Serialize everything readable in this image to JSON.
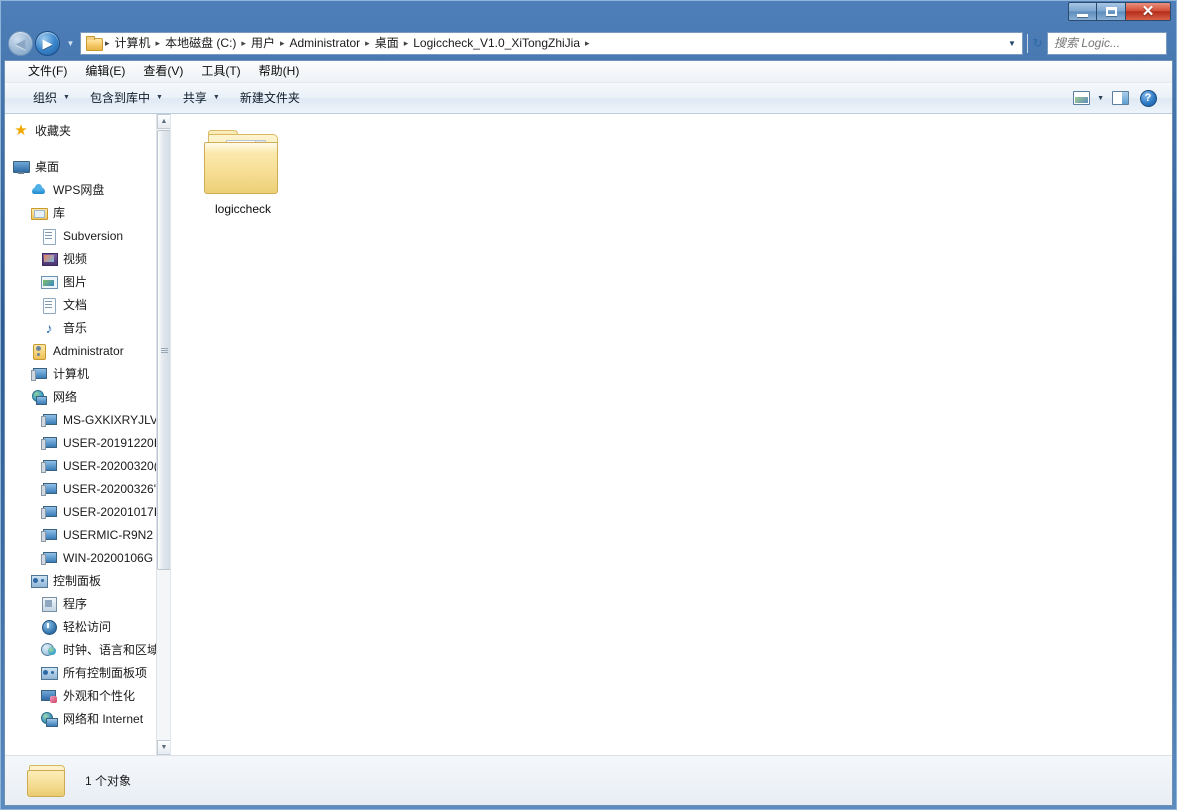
{
  "window": {
    "controls": {
      "minimize": "─",
      "maximize": "□",
      "close": "✕"
    }
  },
  "navbar": {
    "back_glyph": "◀",
    "forward_glyph": "▶",
    "recent_caret": "▼",
    "address_caret": "▼",
    "refresh_glyph": "↻",
    "breadcrumbs": [
      "计算机",
      "本地磁盘 (C:)",
      "用户",
      "Administrator",
      "桌面",
      "Logiccheck_V1.0_XiTongZhiJia"
    ],
    "separator": "▸",
    "search": {
      "placeholder": "搜索 Logic...",
      "value": "",
      "icon": "⚲"
    }
  },
  "menubar": {
    "items": [
      "文件(F)",
      "编辑(E)",
      "查看(V)",
      "工具(T)",
      "帮助(H)"
    ]
  },
  "commandbar": {
    "buttons": [
      {
        "label": "组织",
        "caret": "▼"
      },
      {
        "label": "包含到库中",
        "caret": "▼"
      },
      {
        "label": "共享",
        "caret": "▼"
      },
      {
        "label": "新建文件夹",
        "caret": ""
      }
    ],
    "view_caret": "▼",
    "help_glyph": "?"
  },
  "navpane": {
    "items": [
      {
        "label": "收藏夹",
        "icon": "star-icon",
        "level": 1,
        "gap_after": true
      },
      {
        "label": "桌面",
        "icon": "desktop-icon",
        "level": 1
      },
      {
        "label": "WPS网盘",
        "icon": "cloud-icon",
        "level": 2
      },
      {
        "label": "库",
        "icon": "library-icon",
        "level": 2
      },
      {
        "label": "Subversion",
        "icon": "document-icon",
        "level": 3
      },
      {
        "label": "视频",
        "icon": "video-icon",
        "level": 3
      },
      {
        "label": "图片",
        "icon": "picture-icon",
        "level": 3
      },
      {
        "label": "文档",
        "icon": "document-icon",
        "level": 3
      },
      {
        "label": "音乐",
        "icon": "music-icon",
        "level": 3
      },
      {
        "label": "Administrator",
        "icon": "user-folder-icon",
        "level": 2
      },
      {
        "label": "计算机",
        "icon": "computer-icon",
        "level": 2
      },
      {
        "label": "网络",
        "icon": "network-icon",
        "level": 2
      },
      {
        "label": "MS-GXKIXRYJLV",
        "icon": "computer-icon",
        "level": 3
      },
      {
        "label": "USER-20191220I",
        "icon": "computer-icon",
        "level": 3
      },
      {
        "label": "USER-20200320(",
        "icon": "computer-icon",
        "level": 3
      },
      {
        "label": "USER-20200326'",
        "icon": "computer-icon",
        "level": 3
      },
      {
        "label": "USER-20201017I",
        "icon": "computer-icon",
        "level": 3
      },
      {
        "label": "USERMIC-R9N2\u0015",
        "icon": "computer-icon",
        "level": 3
      },
      {
        "label": "WIN-20200106G",
        "icon": "computer-icon",
        "level": 3
      },
      {
        "label": "控制面板",
        "icon": "control-panel-icon",
        "level": 2
      },
      {
        "label": "程序",
        "icon": "programs-icon",
        "level": 3
      },
      {
        "label": "轻松访问",
        "icon": "ease-of-access-icon",
        "level": 3
      },
      {
        "label": "时钟、语言和区域",
        "icon": "clock-icon",
        "level": 3
      },
      {
        "label": "所有控制面板项",
        "icon": "control-panel-icon",
        "level": 3
      },
      {
        "label": "外观和个性化",
        "icon": "appearance-icon",
        "level": 3
      },
      {
        "label": "网络和 Internet",
        "icon": "network-internet-icon",
        "level": 3
      }
    ],
    "scroll_up": "▲",
    "scroll_down": "▼"
  },
  "content": {
    "items": [
      {
        "name": "logiccheck",
        "type": "folder"
      }
    ]
  },
  "statusbar": {
    "text": "1 个对象"
  }
}
